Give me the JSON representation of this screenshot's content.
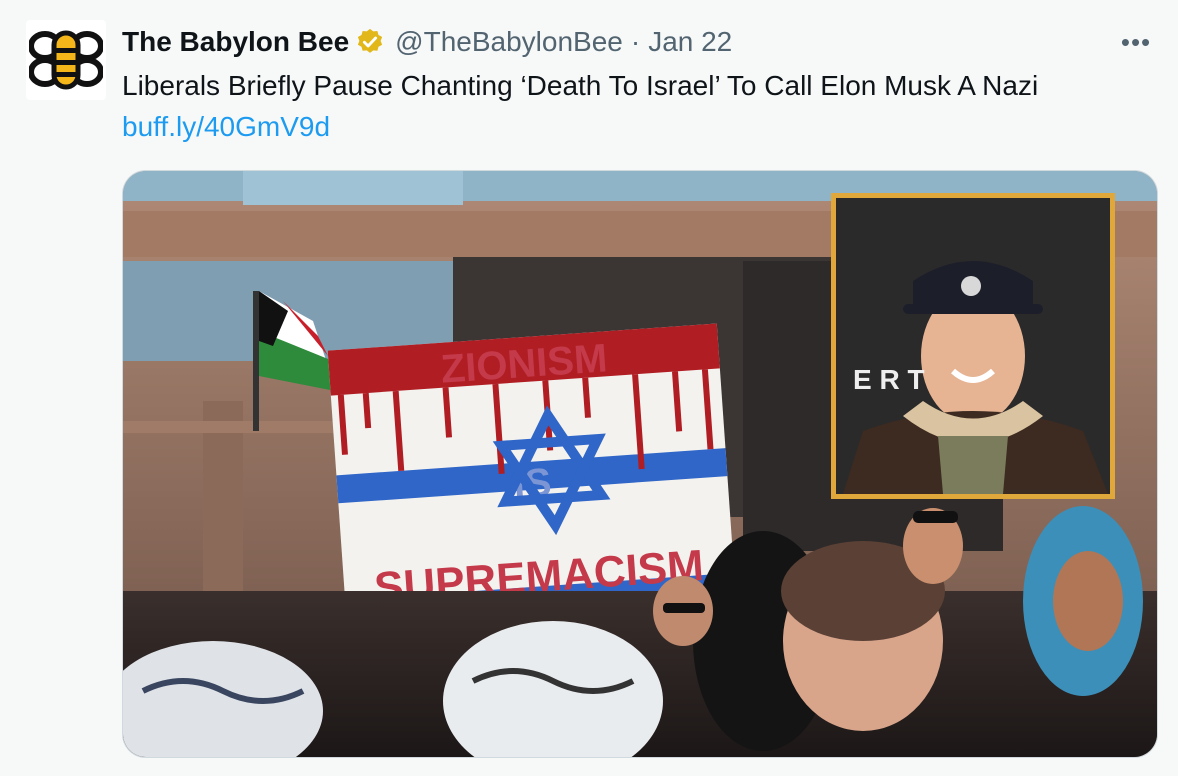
{
  "tweet": {
    "display_name": "The Babylon Bee",
    "handle": "@TheBabylonBee",
    "separator": "·",
    "date": "Jan 22",
    "more_label": "•••",
    "text": "Liberals Briefly Pause Chanting ‘Death To Israel’ To Call Elon Musk A Nazi",
    "link": "buff.ly/40GmV9d",
    "icons": {
      "avatar": "babylon-bee-logo",
      "verified": "verified-badge-icon",
      "more": "more-options-icon"
    },
    "colors": {
      "link": "#1d9bf0",
      "verified_badge": "#e2b719",
      "text": "#0f1419",
      "secondary": "#536471"
    }
  },
  "media": {
    "sign_text": [
      "ZIONISM",
      "IS",
      "SUPREMACISM"
    ]
  }
}
